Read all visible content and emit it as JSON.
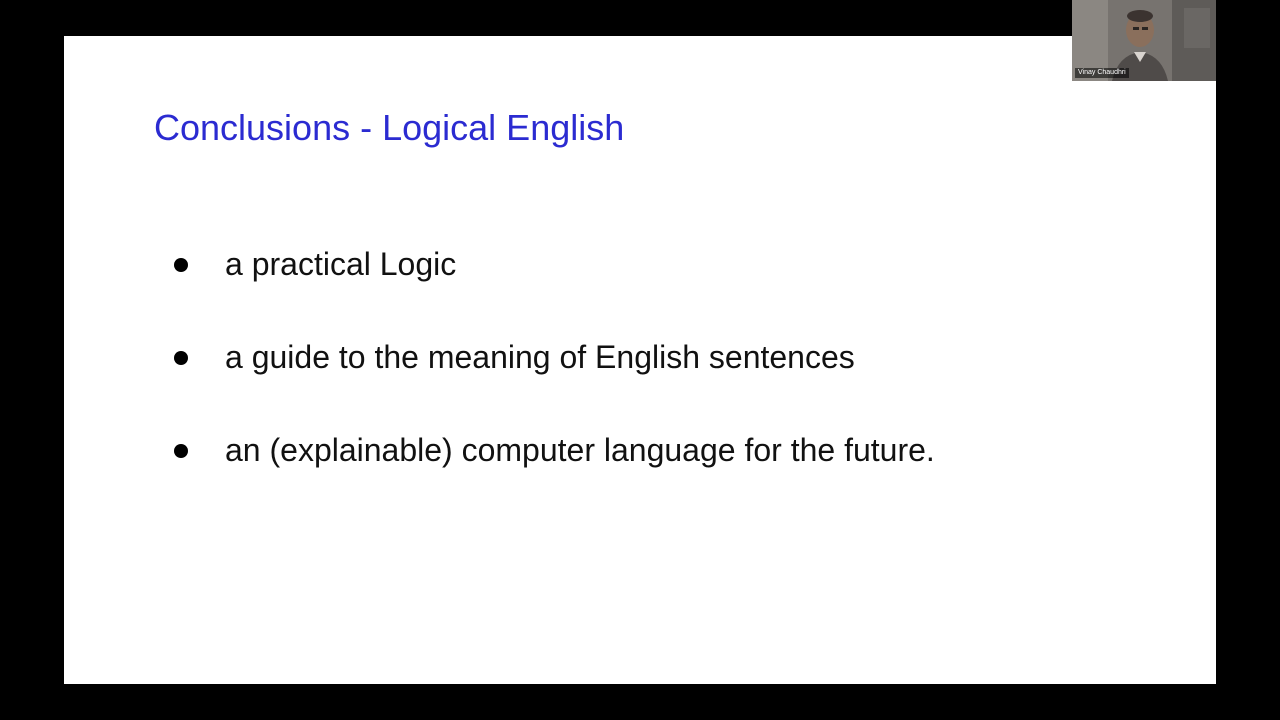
{
  "slide": {
    "title": "Conclusions - Logical English",
    "title_color": "#2b2bd1",
    "bullets": [
      "a practical Logic",
      "a guide to the meaning of English sentences",
      "an (explainable) computer language for the future."
    ]
  },
  "video": {
    "participant_name": "Vinay Chaudhri",
    "icon": "webcam-thumbnail"
  }
}
